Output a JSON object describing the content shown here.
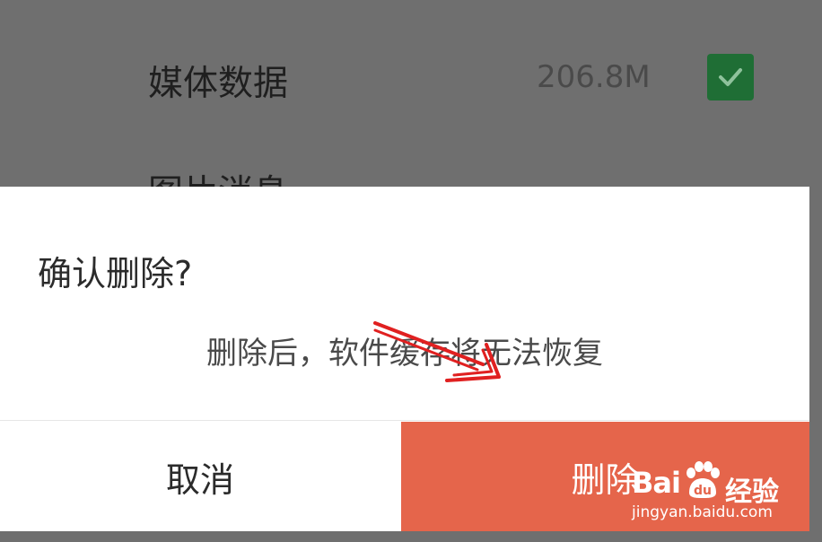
{
  "background": {
    "row_title": "媒体数据",
    "row_size": "206.8M",
    "row_checked": true,
    "next_row_title": "图片消息",
    "check_color": "#1f6e35",
    "overlay_color": "#6f6f6f"
  },
  "dialog": {
    "title": "确认删除?",
    "message": "删除后，软件缓存将无法恢复",
    "cancel_label": "取消",
    "delete_label": "删除",
    "delete_color": "#e5654b"
  },
  "watermark": {
    "brand": "Bai",
    "brand_suffix": "经验",
    "url": "jingyan.baidu.com"
  },
  "annotation": {
    "arrow_color": "#e02020"
  }
}
